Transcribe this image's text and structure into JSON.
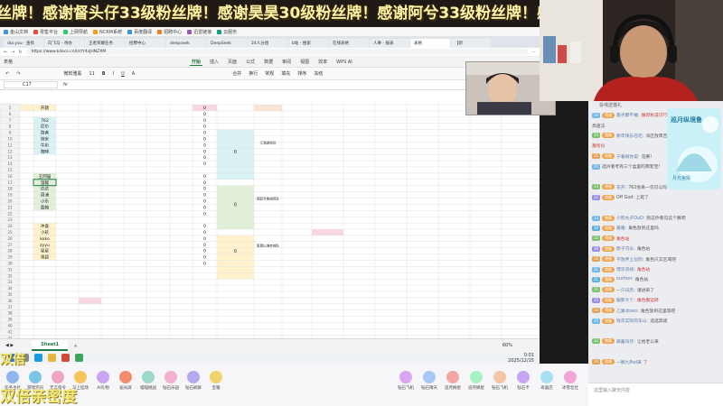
{
  "banner": {
    "text": "丝牌！感谢督头仔33级粉丝牌！感谢昊昊30级粉丝牌！感谢阿兮33级粉丝牌！感"
  },
  "browser": {
    "bookmarks": [
      "金山文档",
      "零售平台",
      "上网导航",
      "NCRM系统",
      "百度翻译",
      "招聘中心",
      "迅雷链接",
      "云服务"
    ],
    "tabs": [
      "dia.you · 查找",
      "向飞马 - 待办",
      "王者荣耀任务",
      "招聘中心",
      "deepseek",
      "DeepSeek",
      "24人分组",
      "b站 - 搜索",
      "在线表格",
      "人事 - 报表",
      "表格",
      "【新"
    ],
    "url": "https://www.kdocs.cn/l/ctY4sJHNZXM"
  },
  "excel": {
    "doc_title": "表格",
    "ribbon": [
      "开始",
      "插入",
      "页面",
      "公式",
      "数据",
      "审阅",
      "视图",
      "效率",
      "WPS AI"
    ],
    "active_ribbon": "开始",
    "font_name": "微软雅黑",
    "font_size": "11",
    "toolbar_items": [
      "合并",
      "换行",
      "常规",
      "填充",
      "排序",
      "冻结"
    ],
    "name_box": "C17",
    "fx": "fx",
    "row_numbers": [
      "5",
      "6",
      "7",
      "8",
      "9",
      "10",
      "11",
      "12",
      "13",
      "14",
      "15",
      "16",
      "17",
      "18",
      "19",
      "20",
      "21",
      "22",
      "23",
      "24",
      "25",
      "26",
      "27",
      "28",
      "29",
      "30",
      "31",
      "32",
      "33",
      "34",
      "35",
      "36",
      "37",
      "38",
      "39",
      "40",
      "41",
      "42"
    ],
    "group1": {
      "names": [
        "开题",
        "",
        "762",
        "尼尔",
        "隐者",
        "炮米",
        "牛彩",
        "咖啡",
        ""
      ],
      "zeros": [
        "0",
        "0",
        "0",
        "0",
        "0",
        "0",
        "0",
        "0",
        "0",
        "0"
      ],
      "score": "0",
      "team": "江湖游戏队"
    },
    "group2": {
      "names": [
        "王阿猫",
        "温暖",
        "达达",
        "周浦",
        "小乐",
        "载翰"
      ],
      "zeros": [
        "0",
        "0",
        "0",
        "0",
        "0",
        "0",
        "0"
      ],
      "score": "0",
      "team": "西起齐鲁组风队"
    },
    "group3": {
      "names": [
        "冲喜",
        "小玖",
        "koko",
        "zyyu",
        "星星",
        "雪碧"
      ],
      "zeros": [
        "0",
        "0",
        "0",
        "0",
        "0",
        "0",
        "0"
      ],
      "score": "0",
      "team": "南望山海赤城队"
    },
    "sheet_tab": "Sheet1",
    "zoom": "60%"
  },
  "taskbar": {
    "date": "2025/12/15",
    "time": "0:01",
    "items": [
      "开始",
      "搜索",
      "Edge",
      "文件",
      "WPS",
      "微信"
    ]
  },
  "chat": {
    "header": "投喂送猫礼",
    "messages": [
      {
        "lv": "14",
        "badge": "傀儡",
        "user": "雷点都不敢:",
        "text": "跟郭秋说可行呢"
      },
      {
        "lv": "",
        "badge": "",
        "user": "",
        "text": "高速法"
      },
      {
        "lv": "15",
        "badge": "傀儡",
        "user": "新年快乐在吃:",
        "text": "派区放草吉"
      },
      {
        "lv": "",
        "badge": "",
        "user": "",
        "text": "鑫钱份"
      },
      {
        "lv": "25",
        "badge": "傀儡",
        "user": "宁着很你说:",
        "text": "竞赛!"
      },
      {
        "lv": "X1",
        "badge": "",
        "user": "",
        "text": "选州者考有三个盒里的那套宝!"
      },
      {
        "lv": "",
        "badge": "",
        "user": "",
        "text": ""
      },
      {
        "lv": "13",
        "badge": "傀儡",
        "user": "花开:",
        "text": "762他来一句可以吗"
      },
      {
        "lv": "22",
        "badge": "傀儡",
        "user": "",
        "text": "Off God: 上班了"
      },
      {
        "lv": "",
        "badge": "",
        "user": "",
        "text": ""
      },
      {
        "lv": "13",
        "badge": "傀儡",
        "user": "小熊丸子OuO:",
        "text": "别这你看见这个赛吧"
      },
      {
        "lv": "19",
        "badge": "傀儡",
        "user": "嘉雅:",
        "text": "角色放到这里吗"
      },
      {
        "lv": "15",
        "badge": "傀儡",
        "user": "",
        "text": "角色站"
      },
      {
        "lv": "19",
        "badge": "傀儡",
        "user": "原子可乐:",
        "text": "角色站"
      },
      {
        "lv": "12",
        "badge": "傀儡",
        "user": "不放弃上位的:",
        "text": "角色只又区域吧"
      },
      {
        "lv": "21",
        "badge": "傀儡",
        "user": "借牙双线:",
        "text": "角色站"
      },
      {
        "lv": "21",
        "badge": "傀儡",
        "user": "ourtion:",
        "text": "角色站"
      },
      {
        "lv": "11",
        "badge": "傀儡",
        "user": "一只日历:",
        "text": "诸进来了"
      },
      {
        "lv": "15",
        "badge": "傀儡",
        "user": "跟卸大丫:",
        "text": "角色服运转"
      },
      {
        "lv": "14",
        "badge": "傀儡",
        "user": "乙乘冰oeo:",
        "text": "角色放到这里等吧"
      },
      {
        "lv": "15",
        "badge": "傀儡",
        "user": "钱花实际的东山:",
        "text": "追选高级"
      },
      {
        "lv": "",
        "badge": "",
        "user": "",
        "text": ""
      },
      {
        "lv": "12",
        "badge": "傀儡",
        "user": "麻酱叫仔:",
        "text": "让给老公来"
      },
      {
        "lv": "",
        "badge": "",
        "user": "",
        "text": ""
      },
      {
        "lv": "14",
        "badge": "傀儡",
        "user": "一颗九Pod来",
        "text": "了"
      }
    ],
    "promo_title": "巡月纵境鲁",
    "promo_sub": "月光宫殿",
    "input_placeholder": "这里输入聊天内容"
  },
  "gifts": [
    {
      "name": "任务主社",
      "sub": ""
    },
    {
      "name": "游戏资讯",
      "sub": ""
    },
    {
      "name": "无言指令",
      "sub": ""
    },
    {
      "name": "马上挂场",
      "sub": ""
    },
    {
      "name": "AI礼物",
      "sub": ""
    },
    {
      "name": "届光屏",
      "sub": ""
    },
    {
      "name": "喵喵挑战",
      "sub": ""
    },
    {
      "name": "钻石乐园",
      "sub": ""
    },
    {
      "name": "钻石刷屏",
      "sub": ""
    },
    {
      "name": "宝箱",
      "sub": ""
    },
    {
      "name": "钻石飞机",
      "sub": ""
    },
    {
      "name": "钻石晴天",
      "sub": ""
    },
    {
      "name": "追月摘星",
      "sub": ""
    },
    {
      "name": "追月摘星",
      "sub": ""
    },
    {
      "name": "钻石飞机",
      "sub": ""
    },
    {
      "name": "钻石卡",
      "sub": ""
    },
    {
      "name": "寿喜店",
      "sub": ""
    },
    {
      "name": "冰雪壮壮",
      "sub": ""
    }
  ],
  "stickers": {
    "top": "双倍",
    "bottom": "双倍亲密度"
  },
  "colors": {
    "cyan_fill": "#d9f2f4",
    "green_fill": "#e2f0d9",
    "yellow_fill": "#fff2cc",
    "pink_fill": "#f8d7e3",
    "excel_green": "#1e7a43"
  }
}
